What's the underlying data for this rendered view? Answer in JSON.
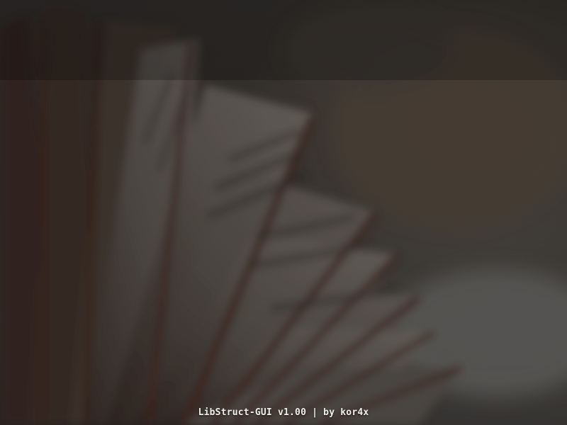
{
  "background": {
    "subject": "blurred open book with fanned pages",
    "colors": {
      "base": "#35322f",
      "page_light": "#6d6660",
      "page_edge": "#4a2e24",
      "band_overlay": "#000000"
    }
  },
  "footer": {
    "credit_text": "LibStruct-GUI v1.00 | by kor4x"
  }
}
